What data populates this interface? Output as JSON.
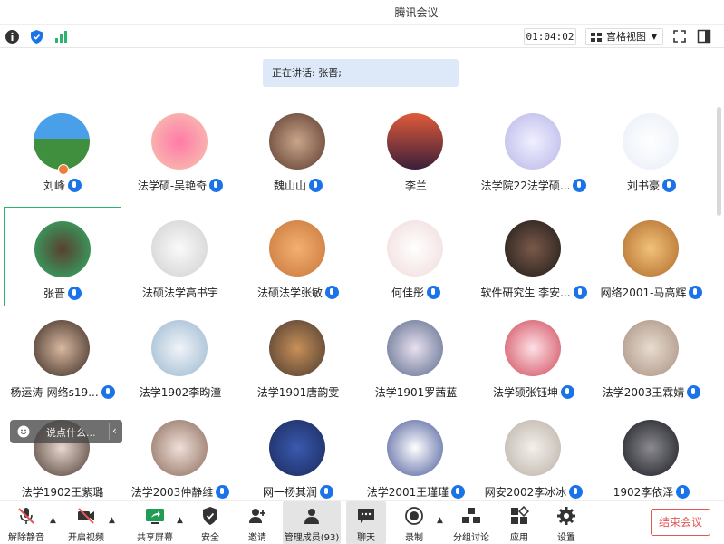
{
  "window": {
    "title": "腾讯会议"
  },
  "toolbar": {
    "timer": "01:04:02",
    "view_label": "宫格视图"
  },
  "speaking": {
    "text": "正在讲话: 张晋;"
  },
  "participants": [
    {
      "name": "刘峰",
      "mic": true,
      "host": true
    },
    {
      "name": "法学硕-吴艳奇",
      "mic": true
    },
    {
      "name": "魏山山",
      "mic": true
    },
    {
      "name": "李兰",
      "mic": false
    },
    {
      "name": "法学院22法学硕...",
      "mic": true
    },
    {
      "name": "刘书豪",
      "mic": true
    },
    {
      "name": "张晋",
      "mic": true,
      "active": true
    },
    {
      "name": "法硕法学高书宇",
      "mic": false
    },
    {
      "name": "法硕法学张敏",
      "mic": true
    },
    {
      "name": "何佳彤",
      "mic": true
    },
    {
      "name": "软件研究生 李安...",
      "mic": true
    },
    {
      "name": "网络2001-马高辉",
      "mic": true
    },
    {
      "name": "杨运涛-网络s19...",
      "mic": true
    },
    {
      "name": "法学1902李昀潼",
      "mic": false
    },
    {
      "name": "法学1901唐韵雯",
      "mic": false
    },
    {
      "name": "法学1901罗茜蓝",
      "mic": false
    },
    {
      "name": "法学硕张钰坤",
      "mic": true
    },
    {
      "name": "法学2003王霖婧",
      "mic": true
    },
    {
      "name": "法学1902王紫璐",
      "mic": false
    },
    {
      "name": "法学2003仲静维",
      "mic": true
    },
    {
      "name": "网一杨其润",
      "mic": true
    },
    {
      "name": "法学2001王瑾瑾",
      "mic": true
    },
    {
      "name": "网安2002李冰冰",
      "mic": true
    },
    {
      "name": "1902李依泽",
      "mic": true
    }
  ],
  "chat_input": {
    "placeholder": "说点什么..."
  },
  "bottom_bar": {
    "unmute": "解除静音",
    "start_video": "开启视频",
    "share_screen": "共享屏幕",
    "security": "安全",
    "invite": "邀请",
    "manage_members": "管理成员(93)",
    "chat": "聊天",
    "record": "录制",
    "breakout": "分组讨论",
    "apps": "应用",
    "settings": "设置",
    "end_meeting": "结束会议"
  },
  "colors": {
    "accent": "#1a73e8",
    "active_border": "#2db46b",
    "end": "#e25656"
  }
}
